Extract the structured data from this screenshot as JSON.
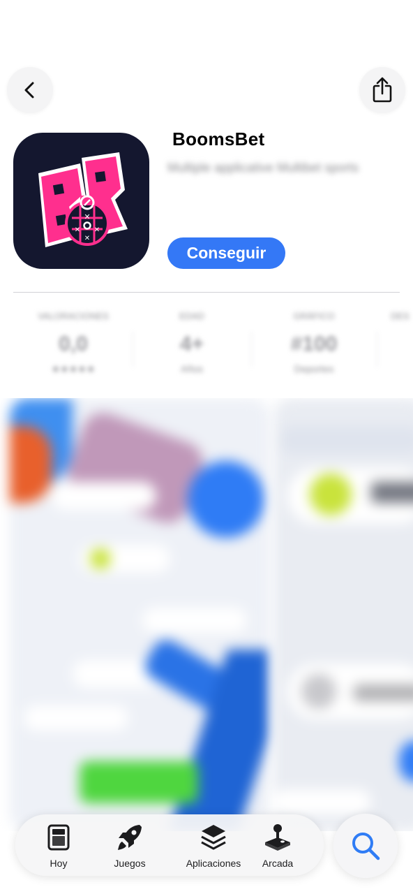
{
  "header": {
    "back_icon": "chevron-left-icon",
    "share_icon": "share-icon"
  },
  "app": {
    "name": "BoomsBet",
    "subtitle": "Multiple applicative Multibet sports",
    "get_label": "Conseguir",
    "icon_name": "boomsbet-logo-icon",
    "icon_bg": "#14172f",
    "icon_accent": "#ff2f8e"
  },
  "info": [
    {
      "label": "Valoraciones",
      "value": "0,0",
      "sub": "★★★★★"
    },
    {
      "label": "Edad",
      "value": "4+",
      "sub": "Años"
    },
    {
      "label": "Gráfico",
      "value": "#100",
      "sub": "Deportes"
    },
    {
      "label": "Des",
      "value": "",
      "sub": ""
    }
  ],
  "tabs": [
    {
      "label": "Hoy",
      "icon": "today-icon"
    },
    {
      "label": "Juegos",
      "icon": "rocket-icon"
    },
    {
      "label": "Aplicaciones",
      "icon": "layers-icon"
    },
    {
      "label": "Arcada",
      "icon": "joystick-icon"
    }
  ],
  "search_icon": "search-icon",
  "colors": {
    "accent": "#3478f6",
    "divider": "#d1d1d6"
  }
}
